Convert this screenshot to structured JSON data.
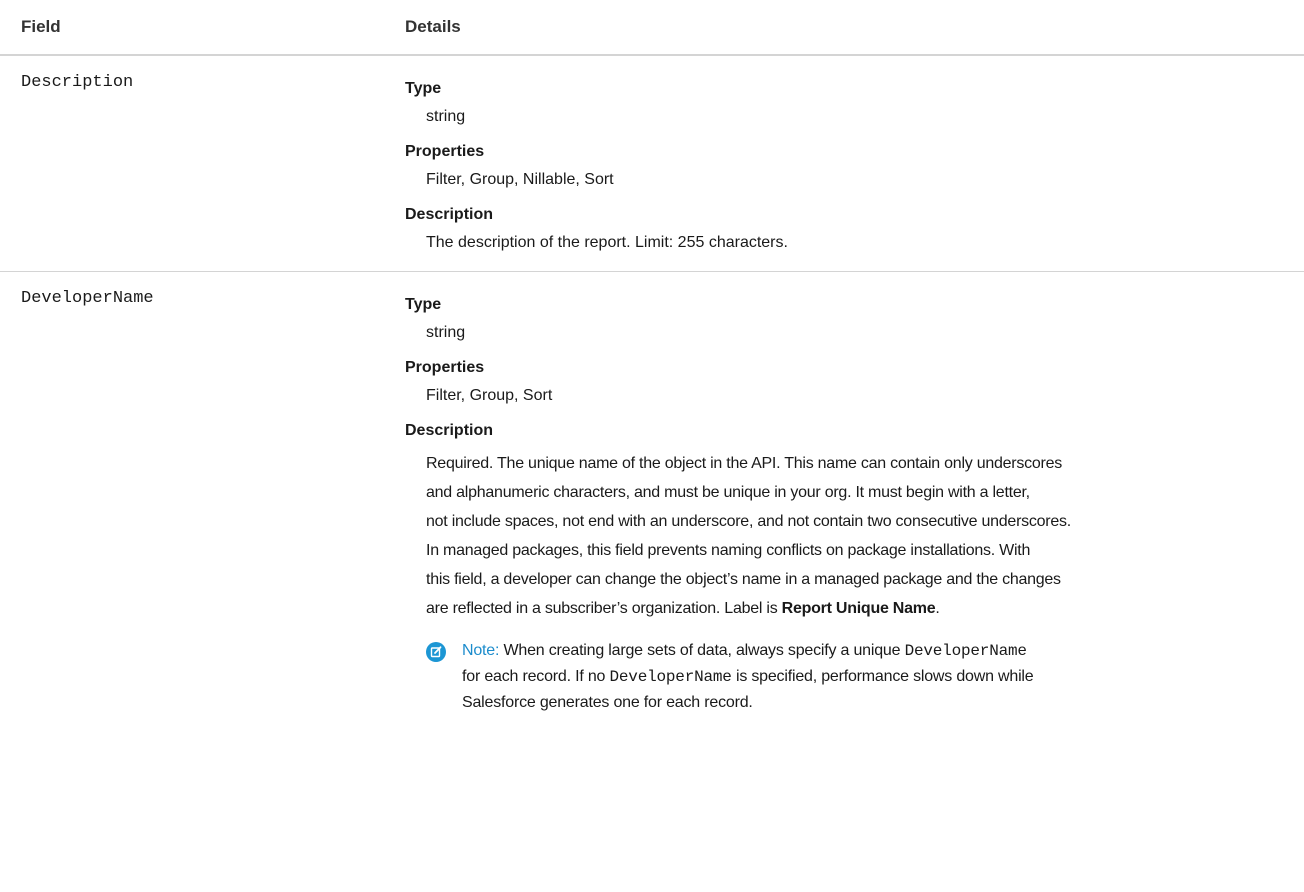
{
  "table": {
    "headers": {
      "field": "Field",
      "details": "Details"
    },
    "rows": [
      {
        "field": "Description",
        "type_label": "Type",
        "type_value": "string",
        "properties_label": "Properties",
        "properties_value": "Filter, Group, Nillable, Sort",
        "description_label": "Description",
        "description_value": "The description of the report. Limit: 255 characters."
      },
      {
        "field": "DeveloperName",
        "type_label": "Type",
        "type_value": "string",
        "properties_label": "Properties",
        "properties_value": "Filter, Group, Sort",
        "description_label": "Description",
        "description_lines": [
          "Required. The unique name of the object in the API. This name can contain only underscores",
          "and alphanumeric characters, and must be unique in your org. It must begin with a letter,",
          "not include spaces, not end with an underscore, and not contain two consecutive underscores.",
          "In managed packages, this field prevents naming conflicts on package installations. With",
          "this field, a developer can change the object’s name in a managed package and the changes",
          "are reflected in a subscriber’s organization. Label is "
        ],
        "description_bold": "Report Unique Name",
        "description_end": ".",
        "note": {
          "label": "Note:",
          "line1_a": " When creating large sets of data, always specify a unique ",
          "line1_code": "DeveloperName",
          "line2_a": "for each record. If no ",
          "line2_code": "DeveloperName",
          "line2_b": " is specified, performance slows down while",
          "line3": "Salesforce generates one for each record."
        }
      }
    ]
  },
  "icons": {
    "note": "edit-note-icon"
  },
  "colors": {
    "note_accent": "#1c96d4",
    "divider": "#d4d4d4"
  }
}
